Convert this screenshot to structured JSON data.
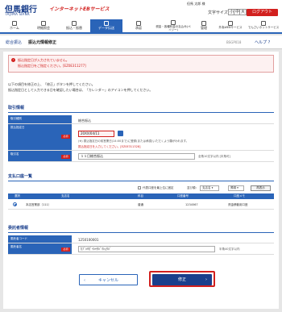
{
  "header": {
    "bank_name": "但馬銀行",
    "bank_name_en": "TAJIMA BANK",
    "service_name": "インターネットEBサービス",
    "user_text": "但馬  太郎 様",
    "font_size_label": "文字サイズ",
    "font_small": "小",
    "font_medium": "中",
    "font_large": "大",
    "logout": "ログアウト"
  },
  "nav": {
    "items": [
      {
        "label": "ホーム",
        "active": false
      },
      {
        "label": "明細照会",
        "active": false
      },
      {
        "label": "振込・振替",
        "active": false
      },
      {
        "label": "データ伝送",
        "active": true
      },
      {
        "label": "承認",
        "active": false
      },
      {
        "label": "税金・各種料金の払込み(ペイジー)",
        "active": false
      },
      {
        "label": "管理",
        "active": false
      },
      {
        "label": "外為WEBサービス",
        "active": false
      },
      {
        "label": "でんさいネットサービス",
        "active": false
      }
    ]
  },
  "sub": {
    "breadcrumb": "総合振込",
    "title": "振込元情報修正",
    "screen_code": "BSGP018",
    "help": "ヘルプ"
  },
  "error": {
    "line1": "振込指定日が入力されていません。",
    "line2": "振込指定日をご指定ください。[EZ0E311277]"
  },
  "intro": {
    "line1": "以下の項目を修正の上、「修正」ボタンを押してください。",
    "line2": "振込指定日として入力できる日を確認したい場合は、「カレンダー」のアイコンを押してください。"
  },
  "transfer_info": {
    "heading": "取引情報",
    "rows": [
      {
        "label": "取引種別",
        "value": "総合振込"
      },
      {
        "label": "振込指定日",
        "required": "必須",
        "value": "20XX/04/11",
        "note1": "(※) 振込指定日の前営業日(14:00まで)に登録(または承認)いただくよう願がわれます。",
        "note2": "振込指定日を入力してください。[EZ0E311328]"
      },
      {
        "label": "取引名",
        "required": "必須",
        "value": "１１日総合振込",
        "note": "全角10文字以内 [半角可]"
      }
    ]
  },
  "account_list": {
    "heading": "支払口座一覧",
    "filter_label": "代表口座を最上位に固定",
    "sort_label": "並び順：",
    "sort_value": "支店名",
    "order_value": "昇順",
    "sort_button": "再表示",
    "columns": [
      "選択",
      "支店名",
      "科目",
      "口座番号",
      "口座メモ"
    ],
    "rows": [
      {
        "branch": "本店営業部（111）",
        "subject": "普通",
        "number": "1234567",
        "memo": "資金移動用口座"
      }
    ]
  },
  "consignor": {
    "heading": "委託者情報",
    "rows": [
      {
        "label": "委託者コード",
        "value": "1250100001"
      },
      {
        "label": "委託者名",
        "required": "必須",
        "value": "ｶﾌﾞｼｷｶﾞｲｼｬﾀｼﾞﾏｼｮｳｼﾞ",
        "note": "半角40文字以内"
      }
    ]
  },
  "buttons": {
    "cancel": "キャンセル",
    "ok": "修正"
  },
  "colors": {
    "brand_blue": "#2a64b8",
    "error_red": "#d2201e",
    "dark_blue": "#1a3f8c"
  }
}
